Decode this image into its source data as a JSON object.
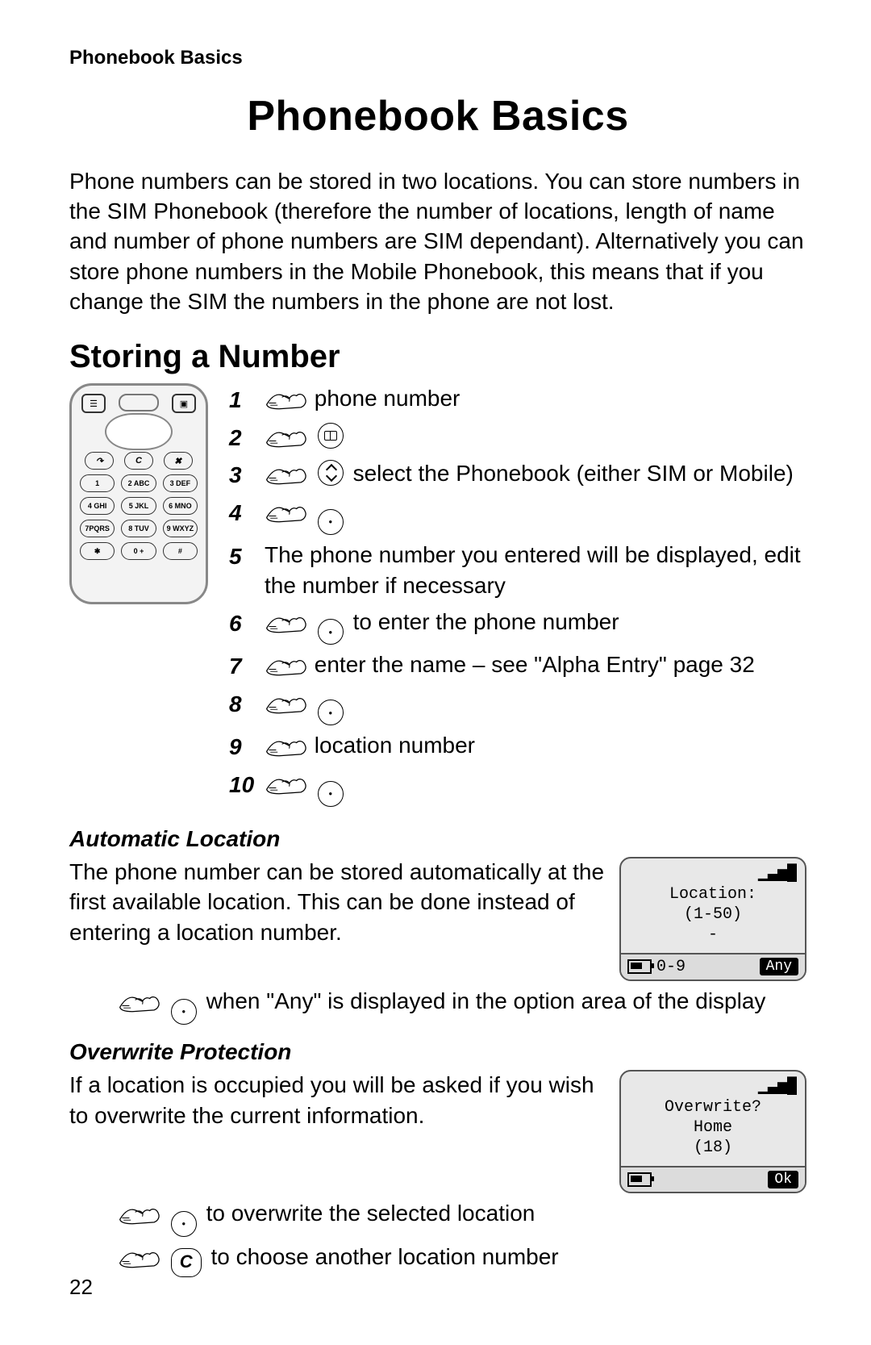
{
  "runhead": "Phonebook Basics",
  "title": "Phonebook Basics",
  "intro": "Phone numbers can be stored in two locations. You can store numbers in the SIM Phonebook (therefore the number of locations, length of name and number of phone numbers are SIM dependant). Alternatively you can store phone numbers in the Mobile Phonebook, this means that if you change the SIM the numbers in the phone are not lost.",
  "section1": "Storing a Number",
  "steps": {
    "s1": "phone number",
    "s3": "select the Phonebook (either SIM or Mobile)",
    "s5": "The phone number you entered will be displayed, edit the number if necessary",
    "s6": "to enter the phone number",
    "s7a": "enter the name – see \"Alpha Entry\" page",
    "s7b": "32",
    "s9": "location number"
  },
  "sub1": "Automatic Location",
  "auto_txt": "The phone number can be stored automatically at the first available location. This can be done instead of entering a location number.",
  "auto_indent": "when \"Any\" is displayed in the option area of the display",
  "sub2": "Overwrite Protection",
  "over_txt": "If a location is occupied you will be asked if you wish to overwrite the current information.",
  "over_a": "to overwrite the selected location",
  "over_b": "to choose another location number",
  "lcd1": {
    "l1": "Location:",
    "l2": "(1-50)",
    "l3": "-",
    "left": "0-9",
    "right": "Any"
  },
  "lcd2": {
    "l1": "Overwrite?",
    "l2": "Home",
    "l3": "(18)",
    "right": "Ok"
  },
  "keypad": [
    "1",
    "2 ABC",
    "3 DEF",
    "4 GHI",
    "5 JKL",
    "6 MNO",
    "7PQRS",
    "8 TUV",
    "9 WXYZ",
    "✱",
    "0 +",
    "#"
  ],
  "c_key": "C",
  "signal": "▞▙▟█",
  "page": "22"
}
